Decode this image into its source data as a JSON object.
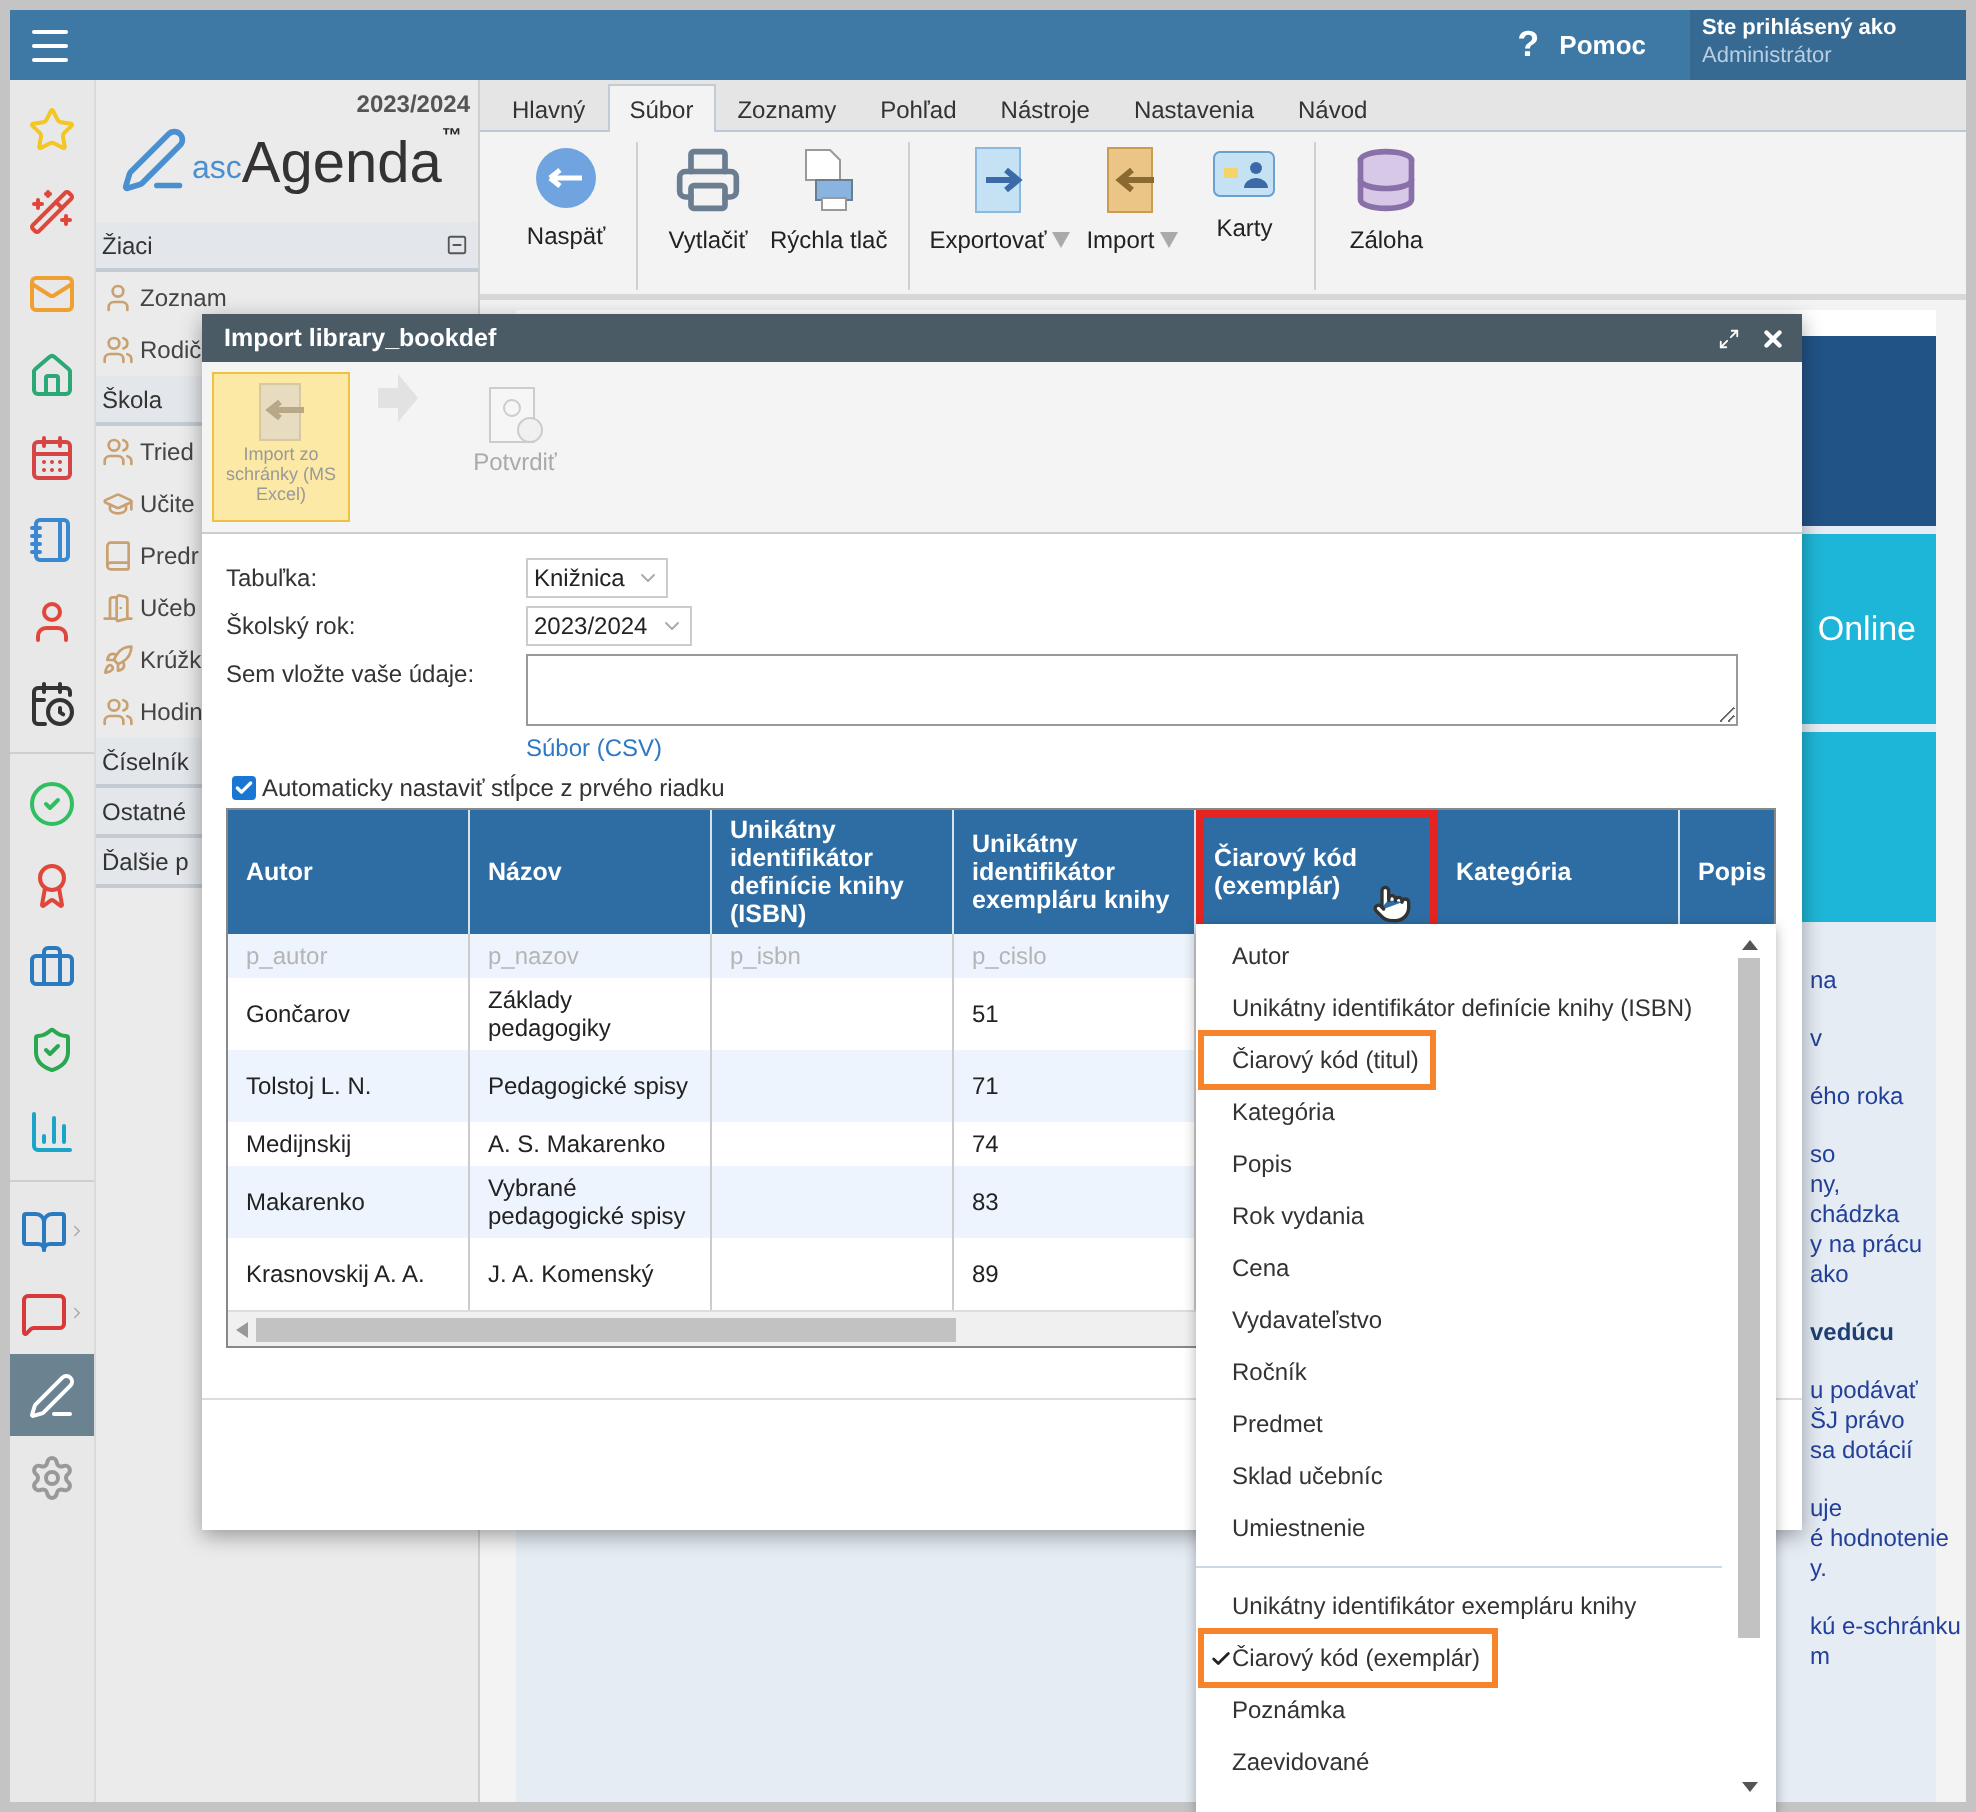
{
  "topbar": {
    "help_mark": "?",
    "help": "Pomoc",
    "user_caption": "Ste prihlásený ako",
    "user_name": "Administrátor"
  },
  "rail": {
    "groups": [
      [
        {
          "selected": false,
          "submenu": false
        },
        {
          "selected": false,
          "submenu": false
        },
        {
          "selected": false,
          "submenu": false
        },
        {
          "selected": false,
          "submenu": false
        },
        {
          "selected": false,
          "submenu": false
        },
        {
          "selected": false,
          "submenu": false
        },
        {
          "selected": false,
          "submenu": false
        },
        {
          "selected": false,
          "submenu": false
        }
      ],
      [
        {
          "selected": false,
          "submenu": false
        },
        {
          "selected": false,
          "submenu": false
        },
        {
          "selected": false,
          "submenu": false
        },
        {
          "selected": false,
          "submenu": false
        },
        {
          "selected": false,
          "submenu": false
        }
      ],
      [
        {
          "selected": false,
          "submenu": true
        },
        {
          "selected": false,
          "submenu": true
        },
        {
          "selected": true,
          "submenu": false
        },
        {
          "selected": false,
          "submenu": false
        }
      ]
    ]
  },
  "sidebar": {
    "year": "2023/2024",
    "logo": {
      "prefix": "asc",
      "name": "Agenda",
      "mark": "™"
    },
    "sections": [
      {
        "title": "Žiaci",
        "collapsible": true,
        "items": [
          {
            "label": "Zoznam"
          },
          {
            "label": "Rodič"
          }
        ]
      },
      {
        "title": "Škola",
        "items": [
          {
            "label": "Tried"
          },
          {
            "label": "Učite"
          },
          {
            "label": "Predr"
          },
          {
            "label": "Učeb"
          },
          {
            "label": "Krúžk"
          },
          {
            "label": "Hodin"
          }
        ]
      },
      {
        "title": "Číselník"
      },
      {
        "title": "Ostatné"
      },
      {
        "title": "Ďalšie p"
      }
    ]
  },
  "ribbon_tabs": [
    {
      "label": "Hlavný",
      "selected": false
    },
    {
      "label": "Súbor",
      "selected": true
    },
    {
      "label": "Zoznamy",
      "selected": false
    },
    {
      "label": "Pohľad",
      "selected": false
    },
    {
      "label": "Nástroje",
      "selected": false
    },
    {
      "label": "Nastavenia",
      "selected": false
    },
    {
      "label": "Návod",
      "selected": false
    }
  ],
  "ribbon_groups": [
    [
      {
        "label": "Naspäť",
        "dropdown": false
      }
    ],
    [
      {
        "label": "Vytlačiť",
        "dropdown": false
      },
      {
        "label": "Rýchla tlač",
        "dropdown": false
      }
    ],
    [
      {
        "label": "Exportovať",
        "dropdown": true
      },
      {
        "label": "Import",
        "dropdown": true
      },
      {
        "label": "Karty",
        "dropdown": false
      }
    ],
    [
      {
        "label": "Záloha",
        "dropdown": false
      }
    ]
  ],
  "tiles": [
    {
      "kind": "dark"
    },
    {
      "kind": "light",
      "label": "Online"
    },
    {
      "kind": "light"
    }
  ],
  "news": [
    {
      "bold": false,
      "lines": [
        "na"
      ]
    },
    {
      "bold": false,
      "lines": [
        "v"
      ]
    },
    {
      "bold": false,
      "lines": [
        "ého roka"
      ]
    },
    {
      "bold": false,
      "lines": [
        "so",
        "ny,",
        "chádzka",
        "y na prácu",
        "ako"
      ]
    },
    {
      "bold": true,
      "lines": [
        "vedúcu"
      ]
    },
    {
      "bold": false,
      "lines": [
        "u podávať",
        "ŠJ právo",
        "sa dotácií"
      ]
    },
    {
      "bold": false,
      "lines": [
        "uje",
        "é hodnotenie",
        "y."
      ]
    },
    {
      "bold": false,
      "lines": [
        "kú e-schránku",
        "m"
      ]
    }
  ],
  "dialog": {
    "title": "Import library_bookdef",
    "steps": [
      {
        "label": "Import zo schránky (MS Excel)",
        "selected": true,
        "disabled": false
      },
      {
        "label": "Potvrdiť",
        "selected": false,
        "disabled": true
      }
    ],
    "table_field": {
      "label": "Tabuľka:",
      "value": "Knižnica"
    },
    "year_field": {
      "label": "Školský rok:",
      "value": "2023/2024"
    },
    "paste_field": {
      "label": "Sem vložte vaše údaje:"
    },
    "file_link": "Súbor (CSV)",
    "auto_columns": {
      "label": "Automaticky nastaviť stĺpce z prvého riadku",
      "checked": true
    },
    "table": {
      "columns": [
        {
          "label": "Autor",
          "outlined": false
        },
        {
          "label": "Názov",
          "outlined": false
        },
        {
          "label": "Unikátny identifikátor definície knihy (ISBN)",
          "outlined": false
        },
        {
          "label": "Unikátny identifikátor exempláru knihy",
          "outlined": false
        },
        {
          "label": "Čiarový kód (exemplár)",
          "outlined": true
        },
        {
          "label": "Kategória",
          "outlined": false
        },
        {
          "label": "Popis",
          "outlined": false
        }
      ],
      "hints": [
        "p_autor",
        "p_nazov",
        "p_isbn",
        "p_cislo"
      ],
      "rows": [
        [
          "Gončarov",
          "Základy pedagogiky",
          "",
          "51"
        ],
        [
          "Tolstoj L. N.",
          "Pedagogické spisy",
          "",
          "71"
        ],
        [
          "Medijnskij",
          "A. S. Makarenko",
          "",
          "74"
        ],
        [
          "Makarenko",
          "Vybrané pedagogické spisy",
          "",
          "83"
        ],
        [
          "Krasnovskij A. A.",
          "J. A. Komenský",
          "",
          "89"
        ]
      ]
    }
  },
  "column_menu": {
    "groups": [
      [
        {
          "label": "Autor",
          "checked": false,
          "highlighted": false
        },
        {
          "label": "Unikátny identifikátor definície knihy (ISBN)",
          "checked": false,
          "highlighted": false
        },
        {
          "label": "Čiarový kód (titul)",
          "checked": false,
          "highlighted": true
        },
        {
          "label": "Kategória",
          "checked": false,
          "highlighted": false
        },
        {
          "label": "Popis",
          "checked": false,
          "highlighted": false
        },
        {
          "label": "Rok vydania",
          "checked": false,
          "highlighted": false
        },
        {
          "label": "Cena",
          "checked": false,
          "highlighted": false
        },
        {
          "label": "Vydavateľstvo",
          "checked": false,
          "highlighted": false
        },
        {
          "label": "Ročník",
          "checked": false,
          "highlighted": false
        },
        {
          "label": "Predmet",
          "checked": false,
          "highlighted": false
        },
        {
          "label": "Sklad učebníc",
          "checked": false,
          "highlighted": false
        },
        {
          "label": "Umiestnenie",
          "checked": false,
          "highlighted": false
        }
      ],
      [
        {
          "label": "Unikátny identifikátor exempláru knihy",
          "checked": false,
          "highlighted": false
        },
        {
          "label": "Čiarový kód (exemplár)",
          "checked": true,
          "highlighted": true
        },
        {
          "label": "Poznámka",
          "checked": false,
          "highlighted": false
        },
        {
          "label": "Zaevidované",
          "checked": false,
          "highlighted": false
        }
      ]
    ]
  }
}
